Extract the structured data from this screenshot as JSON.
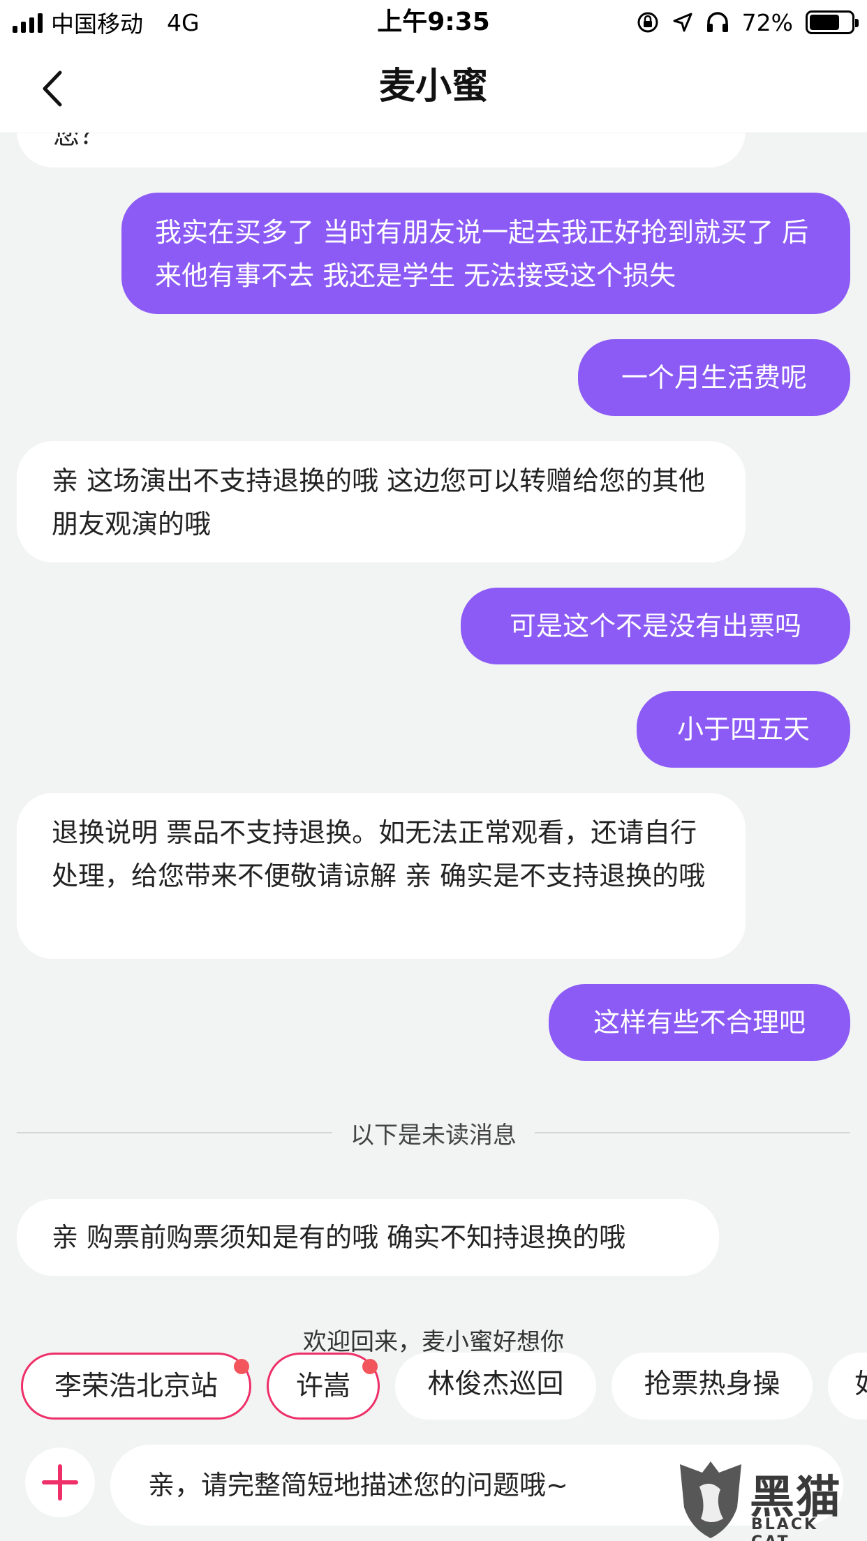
{
  "status_bar": {
    "carrier": "中国移动",
    "network": "4G",
    "time": "上午9:35",
    "battery": "72%",
    "battery_level": 0.72
  },
  "header": {
    "title": "麦小蜜"
  },
  "messages": [
    {
      "side": "left",
      "text": "您？"
    },
    {
      "side": "right",
      "text": "我实在买多了 当时有朋友说一起去我正好抢到就买了 后来他有事不去 我还是学生 无法接受这个损失"
    },
    {
      "side": "right",
      "text": "一个月生活费呢"
    },
    {
      "side": "left",
      "text": "亲 这场演出不支持退换的哦 这边您可以转赠给您的其他朋友观演的哦"
    },
    {
      "side": "right",
      "text": "可是这个不是没有出票吗"
    },
    {
      "side": "right",
      "text": "小于四五天"
    },
    {
      "side": "left",
      "text": "退换说明 票品不支持退换。如无法正常观看，还请自行处理，给您带来不便敬请谅解 亲 确实是不支持退换的哦"
    },
    {
      "side": "right",
      "text": "这样有些不合理吧"
    },
    {
      "side": "left",
      "text": "亲 购票前购票须知是有的哦 确实不知持退换的哦"
    }
  ],
  "unread_divider": "以下是未读消息",
  "welcome": "欢迎回来，麦小蜜好想你",
  "chips": [
    {
      "label": "李荣浩北京站",
      "hot": true
    },
    {
      "label": "许嵩",
      "hot": true
    },
    {
      "label": "林俊杰巡回",
      "hot": false
    },
    {
      "label": "抢票热身操",
      "hot": false
    },
    {
      "label": "如",
      "hot": false
    }
  ],
  "input": {
    "placeholder": "亲，请完整简短地描述您的问题哦~"
  },
  "watermark": {
    "text": "黑猫",
    "sub": "BLACK CAT"
  },
  "colors": {
    "user_bubble": "#8c5bf5",
    "accent_pink": "#ee2f68",
    "badge_dot": "#f2555c"
  }
}
